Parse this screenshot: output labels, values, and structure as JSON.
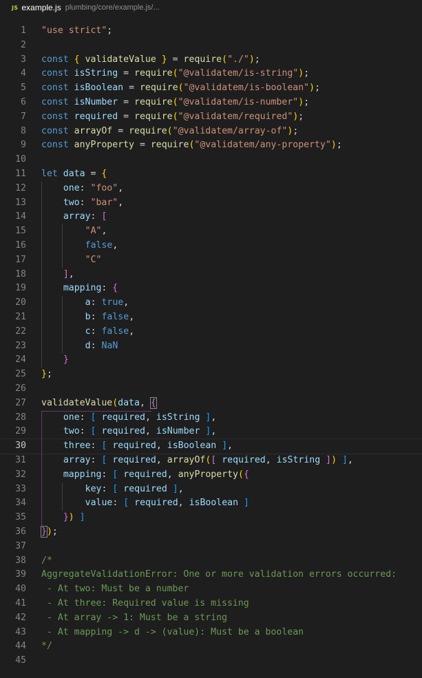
{
  "tab": {
    "icon_label": "JS",
    "title": "example.js",
    "path": "plumbing/core/example.js/..."
  },
  "code_lines": [
    "\"use strict\";",
    "",
    "const { validateValue } = require(\"./\");",
    "const isString = require(\"@validatem/is-string\");",
    "const isBoolean = require(\"@validatem/is-boolean\");",
    "const isNumber = require(\"@validatem/is-number\");",
    "const required = require(\"@validatem/required\");",
    "const arrayOf = require(\"@validatem/array-of\");",
    "const anyProperty = require(\"@validatem/any-property\");",
    "",
    "let data = {",
    "    one: \"foo\",",
    "    two: \"bar\",",
    "    array: [",
    "        \"A\",",
    "        false,",
    "        \"C\"",
    "    ],",
    "    mapping: {",
    "        a: true,",
    "        b: false,",
    "        c: false,",
    "        d: NaN",
    "    }",
    "};",
    "",
    "validateValue(data, {",
    "    one: [ required, isString ],",
    "    two: [ required, isNumber ],",
    "    three: [ required, isBoolean ],",
    "    array: [ required, arrayOf([ required, isString ]) ],",
    "    mapping: [ required, anyProperty({",
    "        key: [ required ],",
    "        value: [ required, isBoolean ]",
    "    }) ]",
    "});",
    "",
    "/*",
    "AggregateValidationError: One or more validation errors occurred:",
    " - At two: Must be a number",
    " - At three: Required value is missing",
    " - At array -> 1: Must be a string",
    " - At mapping -> d -> (value): Must be a boolean",
    "*/",
    ""
  ],
  "line_numbers": [
    "1",
    "2",
    "3",
    "4",
    "5",
    "6",
    "7",
    "8",
    "9",
    "10",
    "11",
    "12",
    "13",
    "14",
    "15",
    "16",
    "17",
    "18",
    "19",
    "20",
    "21",
    "22",
    "23",
    "24",
    "25",
    "26",
    "27",
    "28",
    "29",
    "30",
    "31",
    "32",
    "33",
    "34",
    "35",
    "36",
    "37",
    "38",
    "39",
    "40",
    "41",
    "42",
    "43",
    "44",
    "45"
  ],
  "editor": {
    "active_line": 30
  },
  "colors": {
    "background": "#1e1e1e",
    "keyword": "#569cd6",
    "variable": "#9cdcfe",
    "function": "#dcdcaa",
    "string": "#ce9178",
    "comment": "#6a9955",
    "bracket_level1": "#ffd700",
    "bracket_level2": "#da70d6",
    "bracket_level3": "#179fff",
    "js_icon": "#cbcb41"
  }
}
